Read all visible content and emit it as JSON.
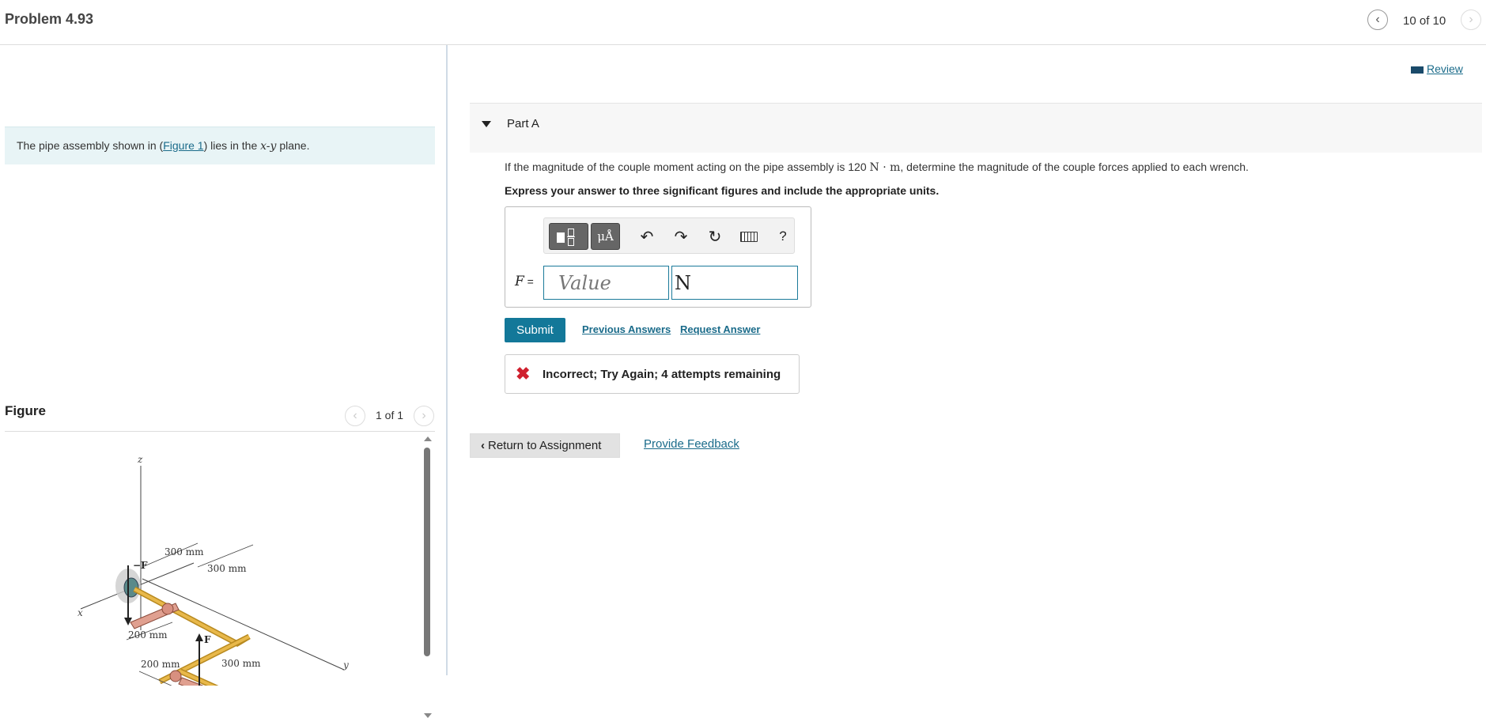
{
  "header": {
    "title": "Problem 4.93",
    "position": "10 of 10"
  },
  "intro": {
    "prefix": "The pipe assembly shown in (",
    "figure_link": "Figure 1",
    "middle": ") lies in the ",
    "plane_math": "x-y",
    "suffix": " plane."
  },
  "figure": {
    "label": "Figure",
    "position": "1 of 1",
    "labels": {
      "z": "z",
      "x": "x",
      "y": "y",
      "neg_f": "−F",
      "f": "F",
      "d1": "300 mm",
      "d2": "300 mm",
      "d3": "200 mm",
      "d4": "200 mm",
      "d5": "300 mm"
    }
  },
  "review": {
    "label": "Review"
  },
  "partA": {
    "label": "Part A",
    "question_prefix": "If the magnitude of the couple moment acting on the pipe assembly is 120 ",
    "question_unit": "N · m",
    "question_suffix": ", determine the magnitude of the couple forces applied to each wrench.",
    "instruction": "Express your answer to three significant figures and include the appropriate units.",
    "toolbar": {
      "units_button": "μÅ",
      "help": "?"
    },
    "answer": {
      "variable": "F",
      "equals": " =",
      "value_placeholder": "Value",
      "unit_value": "N"
    },
    "submit_label": "Submit",
    "previous_answers": "Previous Answers",
    "request_answer": "Request Answer",
    "feedback": "Incorrect; Try Again; 4 attempts remaining"
  },
  "footer": {
    "return_label": "Return to Assignment",
    "feedback_link": "Provide Feedback"
  },
  "colors": {
    "accent": "#137899",
    "link": "#1a6b8a",
    "error": "#d0202e",
    "intro_bg": "#e8f4f6",
    "pipe": "#e8b84a",
    "wrench": "#e0a090"
  }
}
